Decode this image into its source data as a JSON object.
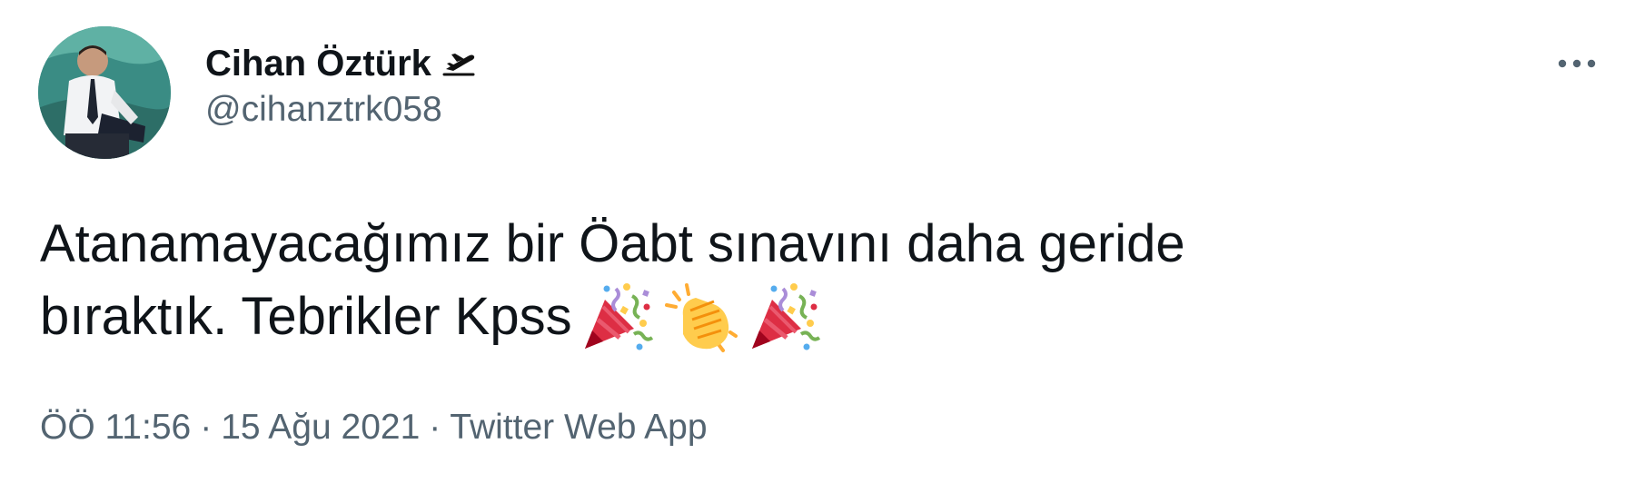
{
  "user": {
    "display_name": "Cihan Öztürk",
    "name_emoji": "airplane-departure-icon",
    "handle": "@cihanztrk058"
  },
  "tweet": {
    "text_line1": "Atanamayacağımız bir Öabt sınavını daha geride",
    "text_line2": "bıraktık. Tebrikler Kpss",
    "emojis": [
      "party-popper-icon",
      "clapping-hands-icon",
      "party-popper-icon"
    ]
  },
  "meta": {
    "time": "ÖÖ 11:56",
    "separator": "·",
    "date": "15 Ağu 2021",
    "source": "Twitter Web App"
  },
  "colors": {
    "text": "#0f1419",
    "secondary": "#536471",
    "background": "#ffffff"
  }
}
